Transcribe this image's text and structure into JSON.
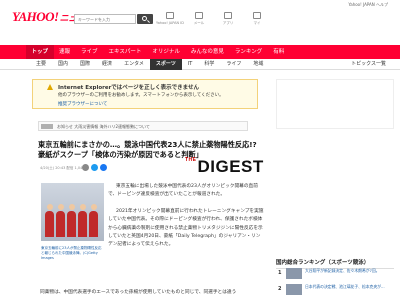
{
  "header": {
    "top_links": "Yahoo! JAPAN ヘルプ",
    "logo": "YAHOO!",
    "logo_sub": "ニュース",
    "search_placeholder": "キーワードを入力",
    "icons": [
      {
        "name": "Yahoo! JAPAN ID",
        "icon": "id-icon"
      },
      {
        "name": "メール",
        "icon": "mail-icon"
      },
      {
        "name": "アプリ",
        "icon": "app-icon"
      },
      {
        "name": "マイ",
        "icon": "my-icon"
      }
    ]
  },
  "nav": {
    "items": [
      "トップ",
      "速報",
      "ライブ",
      "エキスパート",
      "オリジナル",
      "みんなの意見",
      "ランキング",
      "有料"
    ],
    "active_index": 0
  },
  "subnav": {
    "items": [
      "主要",
      "国内",
      "国際",
      "経済",
      "エンタメ",
      "スポーツ",
      "IT",
      "科学",
      "ライフ",
      "地域"
    ],
    "active_index": 5,
    "more": "トピックス一覧"
  },
  "ie_notice": {
    "title": "Internet Explorerではページを正しく表示できません",
    "body": "他のブラウザーのご利用をお勧めします。スマートフォンから表示してください。",
    "link": "推奨ブラウザーについて"
  },
  "site_notice": {
    "text": "お知らせ 大雨災害情報 海外ハリ2速報態勢について"
  },
  "article": {
    "headline": "東京五輪前にまさかの…。競泳中国代表23人に禁止薬物陽性反応!?\n豪紙がスクープ「検体の汚染が原因であると判断」",
    "meta": "4/20(土) 20:43 配信",
    "comment_count": "1,046",
    "source_logo_prefix": "THE",
    "source_logo": "DIGEST",
    "photo_caption": "東京五輪前に23人が禁止薬物陽性反応と報じられた中国競泳陣。(C)Getty Images",
    "paragraphs": [
      "東京五輪に出場した競泳中国代表の23人がオリンピック開幕の直前で、ドーピング違反検査が出ていたことが報道された。",
      "2021年オリンピック開幕直前に行われたトレーニングキャンプを実施していた中国代表。その際にドーピング検査が行われ、保護されたボ検体から心臓病薬の製剤に使用される禁止薬物トリメタジジンに陽性反応を示していたと英国4月20日、豪紙「Daily Telegraph」のジャリアン・リンデン記者によって伝えられた。"
    ],
    "bottom_line": "同薬物は、中国代表選手のエースであった孫楊が使用していたものと同じで、同選手とは違う"
  },
  "ranking": {
    "title": "国内総合ランキング（スポーツ競泳）",
    "items": [
      {
        "rank": "1",
        "text": "大谷翔平が新記録決定、佐々木朗希が7回。"
      },
      {
        "rank": "2",
        "text": "日本代表の決定戦、池江璃花子、松本克央が…"
      }
    ]
  },
  "colors": {
    "brand": "#ff0033",
    "nav_active": "#d5002b",
    "link": "#1a5da3",
    "warning_bg": "#fffbe6"
  }
}
